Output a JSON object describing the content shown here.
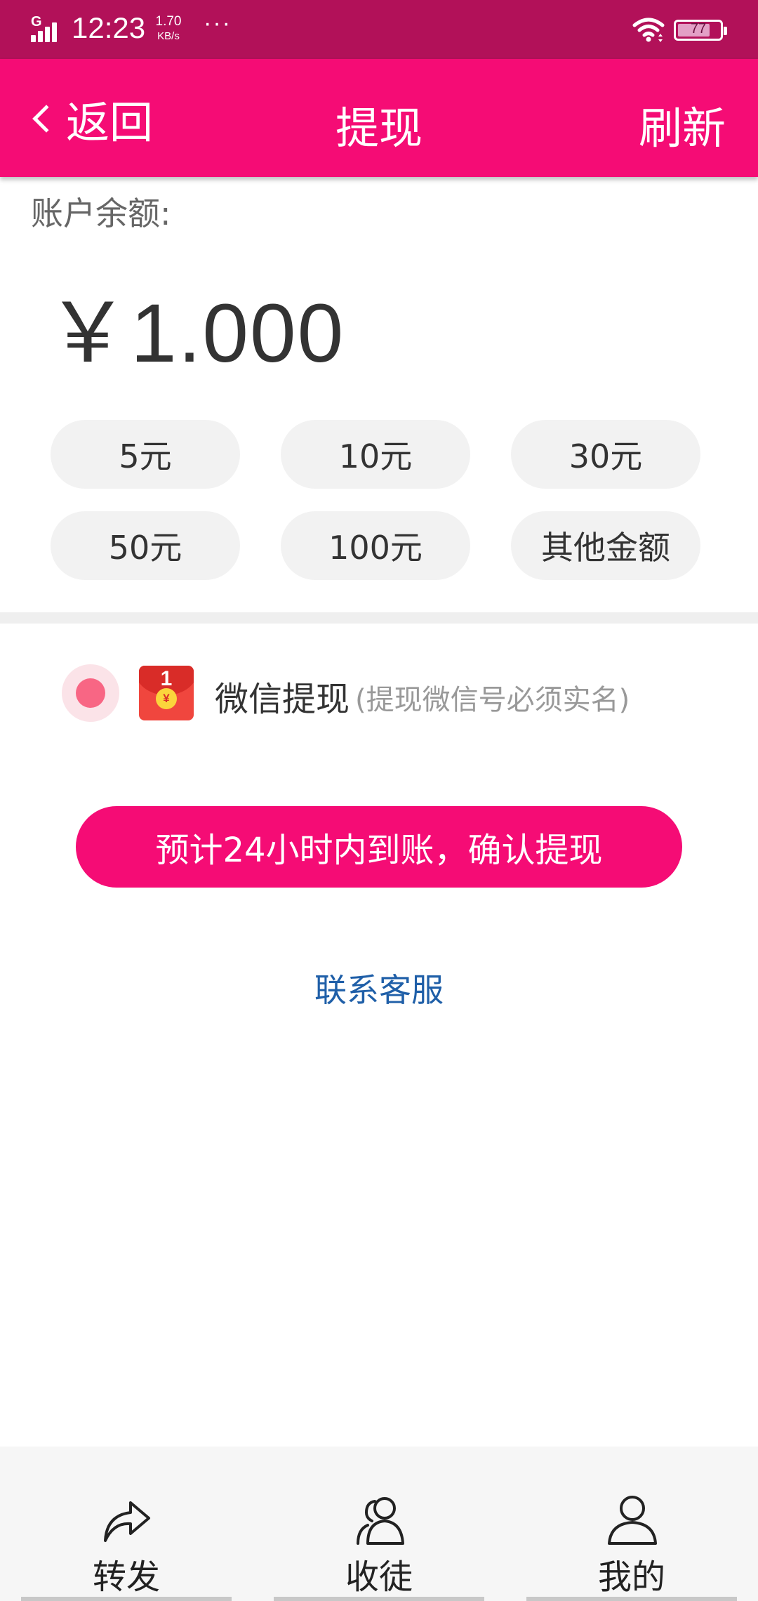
{
  "status_bar": {
    "network": "G",
    "time": "12:23",
    "speed_value": "1.70",
    "speed_unit": "KB/s",
    "more": "···",
    "battery": "77"
  },
  "nav": {
    "back_label": "返回",
    "title": "提现",
    "refresh_label": "刷新"
  },
  "balance": {
    "label": "账户余额:",
    "amount": "￥1.000"
  },
  "amount_options": [
    "5元",
    "10元",
    "30元",
    "50元",
    "100元",
    "其他金额"
  ],
  "payment_method": {
    "name": "微信提现",
    "note": "(提现微信号必须实名)",
    "icon_digit": "1",
    "icon_coin": "¥"
  },
  "confirm_button": "预计24小时内到账，确认提现",
  "contact_link": "联系客服",
  "tabs": [
    {
      "label": "转发",
      "icon": "share-icon"
    },
    {
      "label": "收徒",
      "icon": "users-icon"
    },
    {
      "label": "我的",
      "icon": "user-icon"
    }
  ],
  "colors": {
    "status_bar": "#b21159",
    "accent": "#f50c75",
    "link": "#1f5fa8"
  }
}
